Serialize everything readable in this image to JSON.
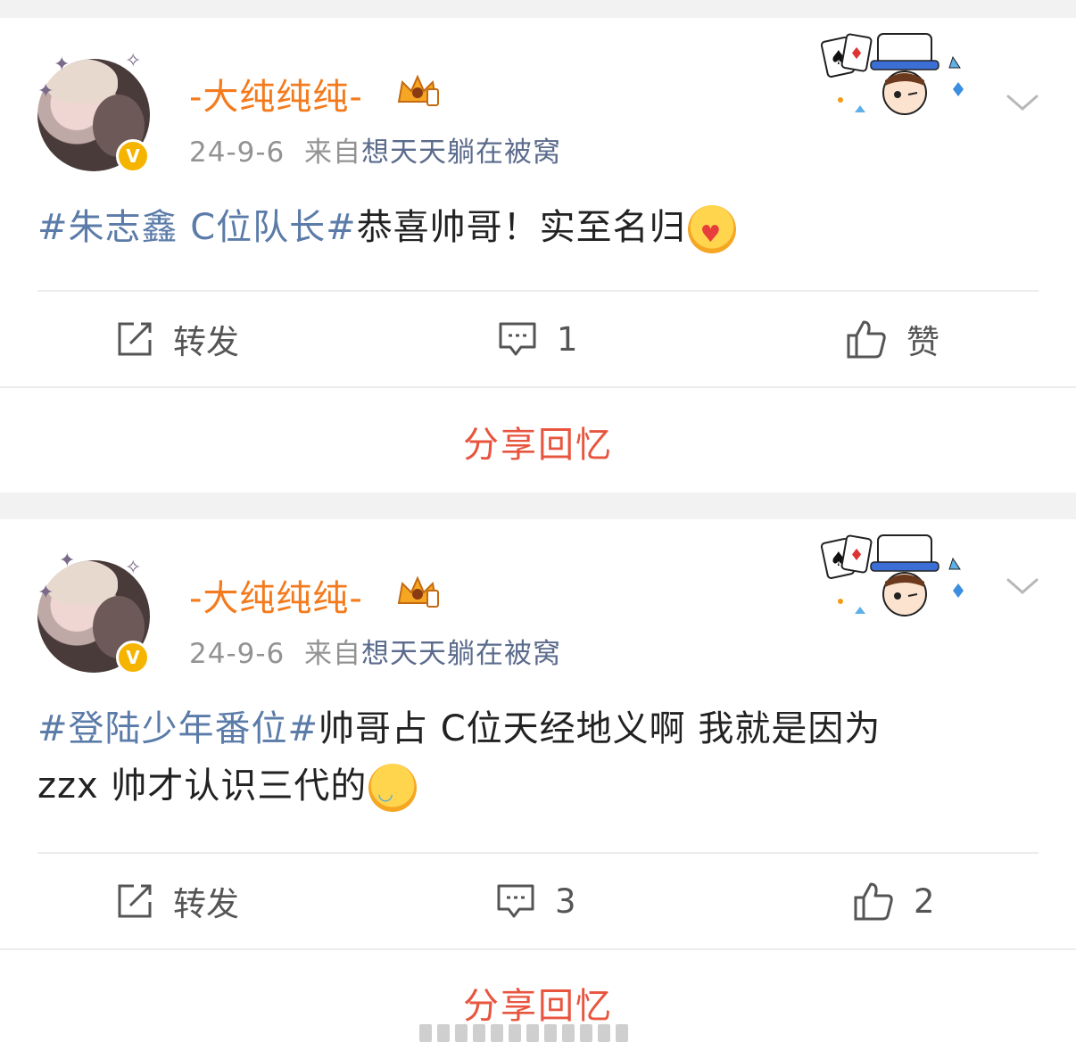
{
  "posts": [
    {
      "username": "-大纯纯纯-",
      "date": "24-9-6",
      "source_prefix": "来自",
      "source": "想天天躺在被窝",
      "content": {
        "topic": "#朱志鑫 C位队长#",
        "text": "恭喜帅哥！实至名归",
        "emoji": "hugging-heart-emoji"
      },
      "actions": {
        "repost_label": "转发",
        "comment_count": "1",
        "like_label": "赞"
      },
      "share_label": "分享回忆"
    },
    {
      "username": "-大纯纯纯-",
      "date": "24-9-6",
      "source_prefix": "来自",
      "source": "想天天躺在被窝",
      "content": {
        "topic": "#登陆少年番位#",
        "text_line1": "帅哥占 C位天经地义啊 我就是因为",
        "text_line2": "zzx 帅才认识三代的",
        "emoji": "laughing-tears-emoji"
      },
      "actions": {
        "repost_label": "转发",
        "comment_count": "3",
        "like_count": "2"
      },
      "share_label": "分享回忆"
    }
  ],
  "colors": {
    "username": "#f47b1d",
    "topic": "#5b7ba8",
    "share": "#e8553f",
    "verified_badge": "#f5b400"
  }
}
